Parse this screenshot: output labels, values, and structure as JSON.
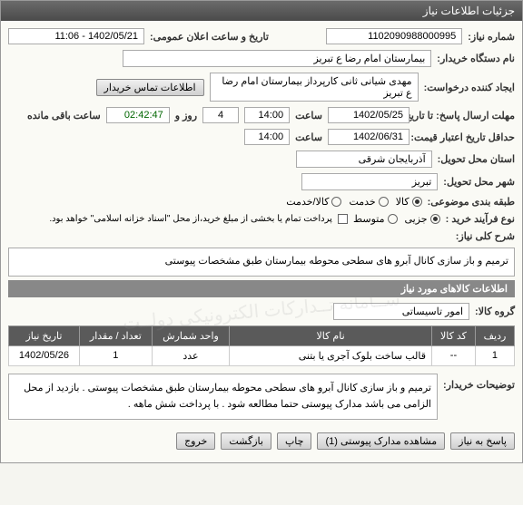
{
  "window_title": "جزئیات اطلاعات نیاز",
  "header": {
    "req_number_label": "شماره نیاز:",
    "req_number": "1102090988000995",
    "announce_label": "تاریخ و ساعت اعلان عمومی:",
    "announce_value": "1402/05/21 - 11:06",
    "buyer_org_label": "نام دستگاه خریدار:",
    "buyer_org": "بیمارستان امام رضا  ع  تبریز",
    "creator_label": "ایجاد کننده درخواست:",
    "creator": "مهدی شیانی ثانی کارپرداز بیمارستان امام رضا  ع  تبریز",
    "contact_btn": "اطلاعات تماس خریدار",
    "deadline_label": "مهلت ارسال پاسخ: تا تاریخ:",
    "deadline_date": "1402/05/25",
    "time_label": "ساعت",
    "deadline_time": "14:00",
    "day_and_label": "روز و",
    "days_left": "4",
    "time_left": "02:42:47",
    "time_left_suffix": "ساعت باقی مانده",
    "validity_label": "حداقل تاریخ اعتبار قیمت: تا تاریخ:",
    "validity_date": "1402/06/31",
    "validity_time": "14:00",
    "province_label": "استان محل تحویل:",
    "province": "آذربایجان شرقی",
    "city_label": "شهر محل تحویل:",
    "city": "تبریز",
    "category_label": "طبقه بندی موضوعی:",
    "cat_kala": "کالا",
    "cat_khadamat": "خدمت",
    "cat_kala_khadamat": "کالا/خدمت",
    "process_label": "نوع فرآیند خرید :",
    "proc_partial": "جزیی",
    "proc_medium": "متوسط",
    "payment_note": "پرداخت تمام یا بخشی از مبلغ خرید،از محل \"اسناد خزانه اسلامی\" خواهد بود."
  },
  "general_desc": {
    "label": "شرح کلی نیاز:",
    "text": "ترمیم و باز سازی کانال آبرو های سطحی محوطه بیمارستان طبق مشخصات پیوستی"
  },
  "items_section": {
    "title": "اطلاعات کالاهای مورد نیاز",
    "group_label": "گروه کالا:",
    "group_value": "امور تاسیساتی"
  },
  "table": {
    "headers": [
      "ردیف",
      "کد کالا",
      "نام کالا",
      "واحد شمارش",
      "تعداد / مقدار",
      "تاریخ نیاز"
    ],
    "rows": [
      {
        "idx": "1",
        "code": "--",
        "name": "قالب ساخت بلوک آجری یا بتنی",
        "unit": "عدد",
        "qty": "1",
        "date": "1402/05/26"
      }
    ]
  },
  "buyer_notes": {
    "label": "توضیحات خریدار:",
    "text": "ترمیم و باز سازی کانال آبرو های سطحی محوطه بیمارستان طبق مشخصات پیوستی . بازدید از محل الزامی می باشد مدارک پیوستی حتما مطالعه شود . با پرداخت شش ماهه ."
  },
  "footer": {
    "respond": "پاسخ به نیاز",
    "attachments": "مشاهده مدارک پیوستی (1)",
    "print": "چاپ",
    "back": "بازگشت",
    "exit": "خروج"
  }
}
